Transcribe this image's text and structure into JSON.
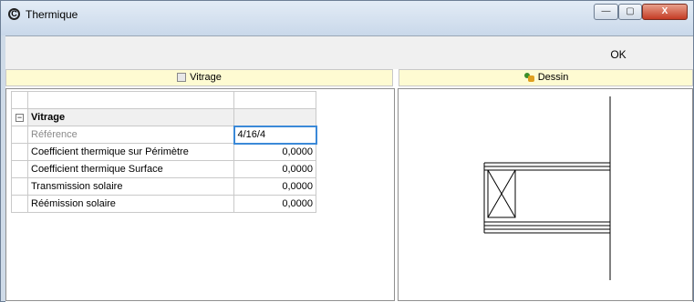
{
  "window": {
    "title": "Thermique",
    "controls": {
      "minimize": "—",
      "maximize": "▢",
      "close": "X"
    }
  },
  "toolbar": {
    "ok_label": "OK"
  },
  "tabs": [
    {
      "label": "Vitrage",
      "icon": "vitrage-icon"
    },
    {
      "label": "Dessin",
      "icon": "drawing-icon"
    }
  ],
  "properties": {
    "category": "Vitrage",
    "rows": [
      {
        "label": "Référence",
        "value": "4/16/4"
      },
      {
        "label": "Coefficient thermique sur Périmètre",
        "value": "0,0000"
      },
      {
        "label": "Coefficient thermique Surface",
        "value": "0,0000"
      },
      {
        "label": "Transmission solaire",
        "value": "0,0000"
      },
      {
        "label": "Réémission solaire",
        "value": "0,0000"
      }
    ]
  }
}
